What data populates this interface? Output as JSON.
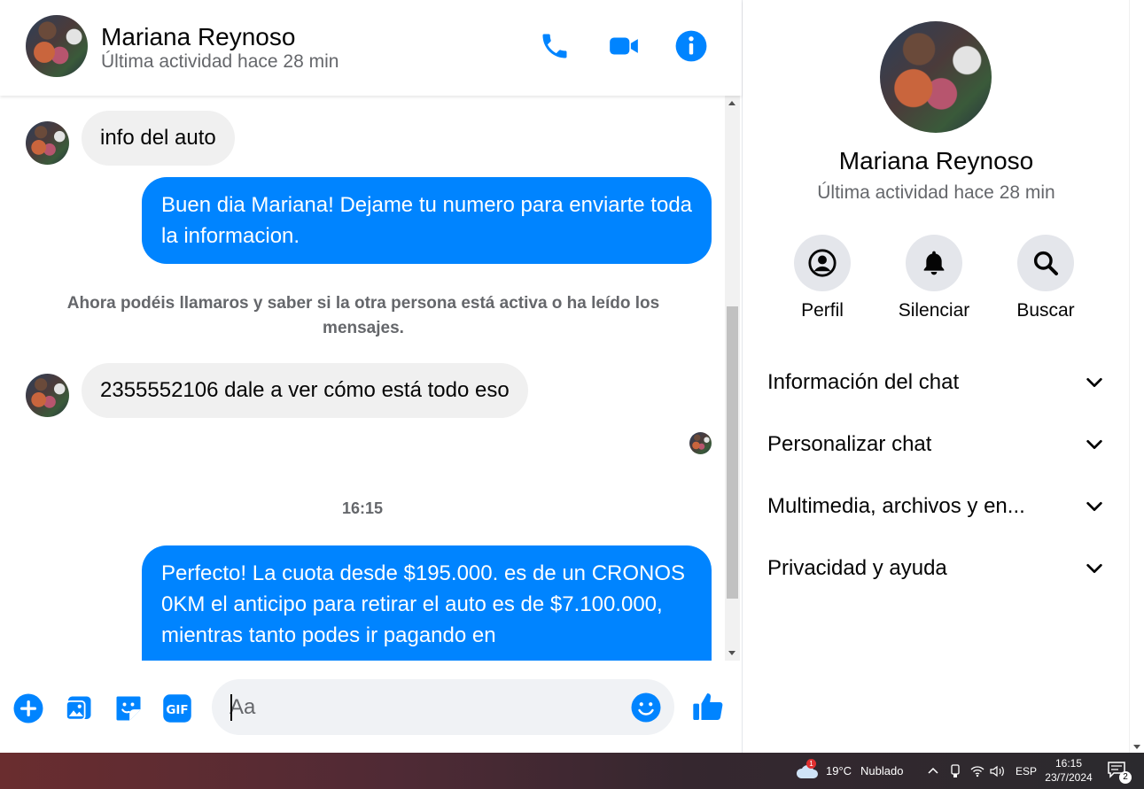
{
  "contact": {
    "name": "Mariana Reynoso",
    "status": "Última actividad hace 28 min"
  },
  "header": {
    "call_icon": "phone-icon",
    "video_icon": "video-camera-icon",
    "info_icon": "info-icon"
  },
  "messages": {
    "m1": "info del auto",
    "m2": "Buen dia Mariana! Dejame tu numero para enviarte toda la informacion.",
    "system_note": "Ahora podéis llamaros y saber si la otra persona está activa o ha leído los mensajes.",
    "m3": "2355552106 dale a ver cómo está todo eso",
    "time_separator": "16:15",
    "m4": "Perfecto! La cuota desde $195.000. es de un CRONOS 0KM el anticipo para retirar el auto es de $7.100.000, mientras tanto podes ir pagando en"
  },
  "composer": {
    "placeholder": "Aa"
  },
  "panel": {
    "actions": {
      "profile": "Perfil",
      "mute": "Silenciar",
      "search": "Buscar"
    },
    "sections": {
      "chat_info": "Información del chat",
      "customize": "Personalizar chat",
      "media": "Multimedia, archivos y en...",
      "privacy": "Privacidad y ayuda"
    }
  },
  "taskbar": {
    "weather_temp": "19°C",
    "weather_text": "Nublado",
    "weather_badge": "1",
    "language": "ESP",
    "time": "16:15",
    "date": "23/7/2024",
    "notifications": "2"
  },
  "colors": {
    "accent": "#0084ff",
    "incoming_bubble": "#f0f0f0",
    "secondary_text": "#65676b"
  }
}
